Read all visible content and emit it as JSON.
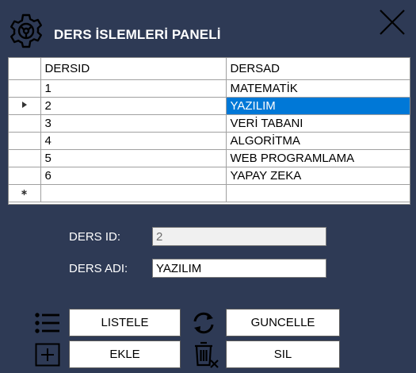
{
  "window": {
    "title": "DERS İSLEMLERİ PANELİ",
    "gear_icon": "gear-icon",
    "close_icon": "close-icon"
  },
  "grid": {
    "columns": [
      "DERSID",
      "DERSAD"
    ],
    "rows": [
      {
        "id": "1",
        "name": "MATEMATİK"
      },
      {
        "id": "2",
        "name": "YAZILIM"
      },
      {
        "id": "3",
        "name": "VERİ TABANI"
      },
      {
        "id": "4",
        "name": "ALGORİTMA"
      },
      {
        "id": "5",
        "name": "WEB PROGRAMLAMA"
      },
      {
        "id": "6",
        "name": "YAPAY ZEKA"
      }
    ],
    "selected_row_index": 1,
    "selection_color": "#0078d7"
  },
  "form": {
    "ders_id_label": "DERS ID:",
    "ders_id_value": "2",
    "ders_adi_label": "DERS ADI:",
    "ders_adi_value": "YAZILIM"
  },
  "buttons": {
    "listele": "LISTELE",
    "guncelle": "GUNCELLE",
    "ekle": "EKLE",
    "sil": "SIL"
  },
  "icons": {
    "listele": "list-icon",
    "guncelle": "refresh-icon",
    "ekle": "add-box-icon",
    "sil": "delete-icon"
  },
  "colors": {
    "background": "#2e3a55",
    "text": "#ffffff"
  }
}
